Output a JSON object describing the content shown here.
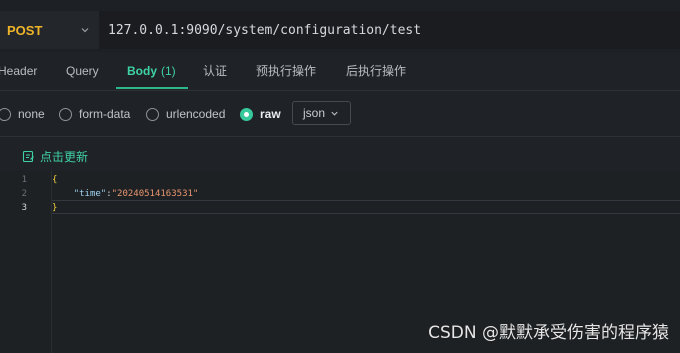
{
  "request": {
    "method": "POST",
    "url": "127.0.0.1:9090/system/configuration/test"
  },
  "tabs": [
    {
      "label": "Header"
    },
    {
      "label": "Query"
    },
    {
      "label": "Body",
      "count": "(1)",
      "active": true
    },
    {
      "label": "认证"
    },
    {
      "label": "预执行操作"
    },
    {
      "label": "后执行操作"
    }
  ],
  "body_types": [
    {
      "label": "none",
      "checked": false
    },
    {
      "label": "form-data",
      "checked": false
    },
    {
      "label": "urlencoded",
      "checked": false
    },
    {
      "label": "raw",
      "checked": true
    }
  ],
  "format_select": {
    "value": "json"
  },
  "update_action": {
    "label": "点击更新",
    "icon": "edit-icon"
  },
  "editor": {
    "line_numbers": [
      "1",
      "2",
      "3"
    ],
    "lines": [
      {
        "open": "{"
      },
      {
        "indent": "    ",
        "key": "\"time\"",
        "colon": ":",
        "value": "\"20240514163531\""
      },
      {
        "close": "}"
      }
    ]
  },
  "watermark": "CSDN @默默承受伤害的程序猿",
  "colors": {
    "accent": "#3fd3a3",
    "method": "#f0b429",
    "background": "#1f2227"
  }
}
